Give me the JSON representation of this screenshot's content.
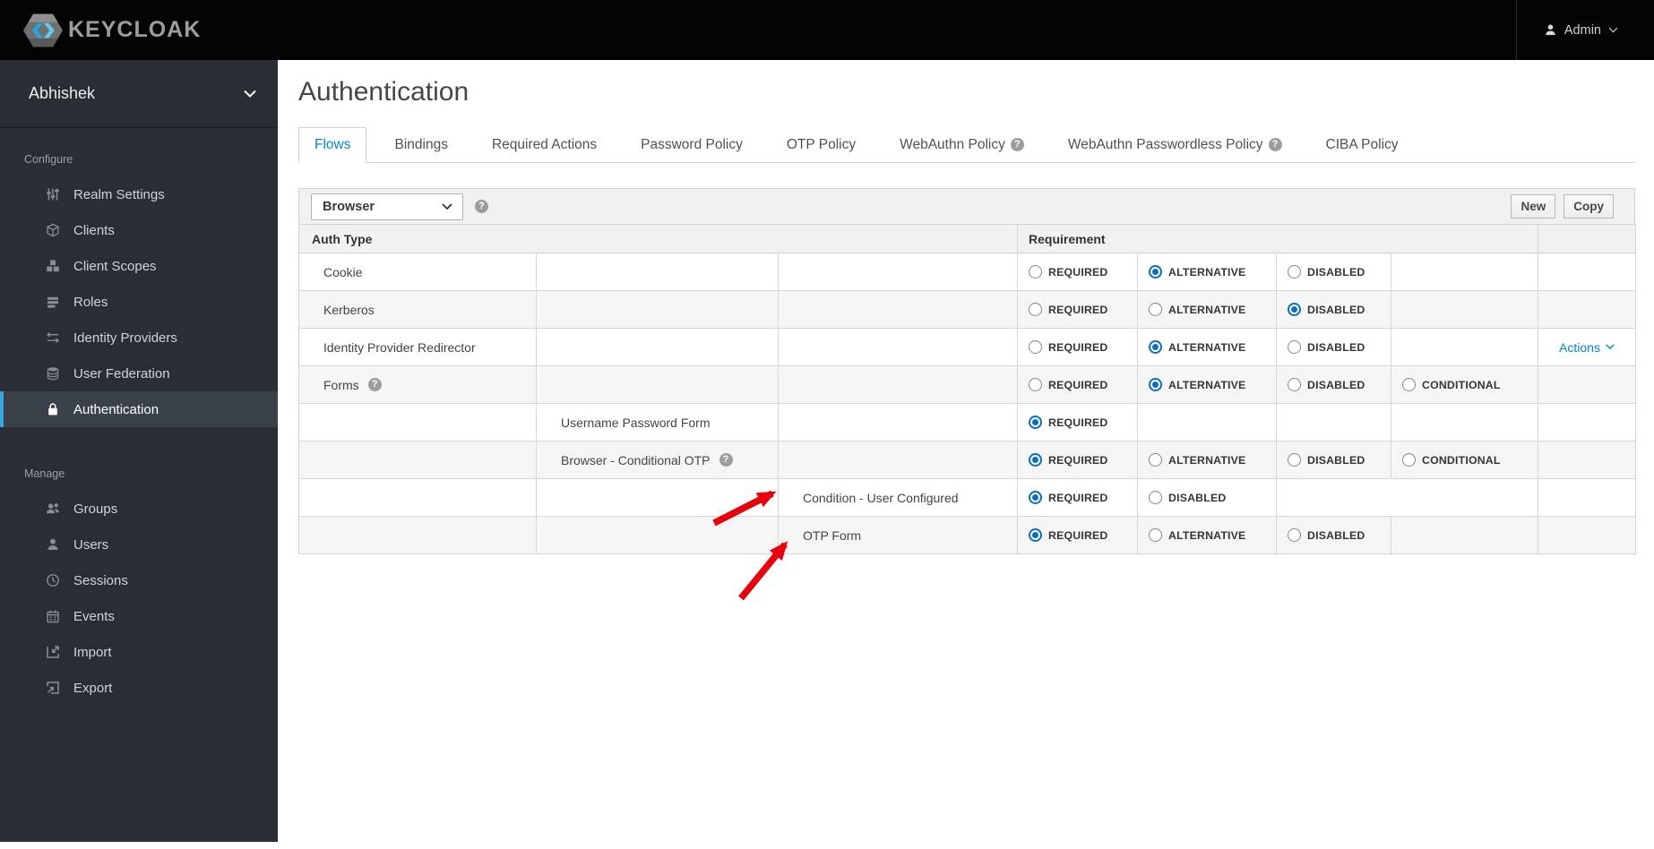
{
  "topbar": {
    "logo_text": "KEYCLOAK",
    "user_label": "Admin"
  },
  "sidebar": {
    "realm": "Abhishek",
    "sections": [
      {
        "label": "Configure",
        "items": [
          {
            "label": "Realm Settings",
            "icon": "sliders-icon",
            "active": false
          },
          {
            "label": "Clients",
            "icon": "cube-icon",
            "active": false
          },
          {
            "label": "Client Scopes",
            "icon": "cubes-icon",
            "active": false
          },
          {
            "label": "Roles",
            "icon": "list-icon",
            "active": false
          },
          {
            "label": "Identity Providers",
            "icon": "exchange-icon",
            "active": false
          },
          {
            "label": "User Federation",
            "icon": "database-icon",
            "active": false
          },
          {
            "label": "Authentication",
            "icon": "lock-icon",
            "active": true
          }
        ]
      },
      {
        "label": "Manage",
        "items": [
          {
            "label": "Groups",
            "icon": "users-icon",
            "active": false
          },
          {
            "label": "Users",
            "icon": "user-icon",
            "active": false
          },
          {
            "label": "Sessions",
            "icon": "clock-icon",
            "active": false
          },
          {
            "label": "Events",
            "icon": "calendar-icon",
            "active": false
          },
          {
            "label": "Import",
            "icon": "import-icon",
            "active": false
          },
          {
            "label": "Export",
            "icon": "export-icon",
            "active": false
          }
        ]
      }
    ]
  },
  "page": {
    "title": "Authentication"
  },
  "tabs": [
    {
      "label": "Flows",
      "active": true,
      "help": false
    },
    {
      "label": "Bindings",
      "active": false,
      "help": false
    },
    {
      "label": "Required Actions",
      "active": false,
      "help": false
    },
    {
      "label": "Password Policy",
      "active": false,
      "help": false
    },
    {
      "label": "OTP Policy",
      "active": false,
      "help": false
    },
    {
      "label": "WebAuthn Policy",
      "active": false,
      "help": true
    },
    {
      "label": "WebAuthn Passwordless Policy",
      "active": false,
      "help": true
    },
    {
      "label": "CIBA Policy",
      "active": false,
      "help": false
    }
  ],
  "toolbar": {
    "flow_select_value": "Browser",
    "new_label": "New",
    "copy_label": "Copy"
  },
  "table": {
    "headers": {
      "auth_type": "Auth Type",
      "requirement": "Requirement"
    },
    "rows": [
      {
        "label": "Cookie",
        "level": 1,
        "help": false,
        "options": [
          {
            "label": "REQUIRED",
            "slot": 0,
            "selected": false
          },
          {
            "label": "ALTERNATIVE",
            "slot": 1,
            "selected": true
          },
          {
            "label": "DISABLED",
            "slot": 2,
            "selected": false
          }
        ]
      },
      {
        "label": "Kerberos",
        "level": 1,
        "help": false,
        "options": [
          {
            "label": "REQUIRED",
            "slot": 0,
            "selected": false
          },
          {
            "label": "ALTERNATIVE",
            "slot": 1,
            "selected": false
          },
          {
            "label": "DISABLED",
            "slot": 2,
            "selected": true
          }
        ]
      },
      {
        "label": "Identity Provider Redirector",
        "level": 1,
        "help": false,
        "actions_label": "Actions",
        "options": [
          {
            "label": "REQUIRED",
            "slot": 0,
            "selected": false
          },
          {
            "label": "ALTERNATIVE",
            "slot": 1,
            "selected": true
          },
          {
            "label": "DISABLED",
            "slot": 2,
            "selected": false
          }
        ]
      },
      {
        "label": "Forms",
        "level": 1,
        "help": true,
        "options": [
          {
            "label": "REQUIRED",
            "slot": 0,
            "selected": false
          },
          {
            "label": "ALTERNATIVE",
            "slot": 1,
            "selected": true
          },
          {
            "label": "DISABLED",
            "slot": 2,
            "selected": false
          },
          {
            "label": "CONDITIONAL",
            "slot": 3,
            "selected": false
          }
        ]
      },
      {
        "label": "Username Password Form",
        "level": 2,
        "help": false,
        "options": [
          {
            "label": "REQUIRED",
            "slot": 0,
            "selected": true
          }
        ]
      },
      {
        "label": "Browser - Conditional OTP",
        "level": 2,
        "help": true,
        "options": [
          {
            "label": "REQUIRED",
            "slot": 0,
            "selected": true
          },
          {
            "label": "ALTERNATIVE",
            "slot": 1,
            "selected": false
          },
          {
            "label": "DISABLED",
            "slot": 2,
            "selected": false
          },
          {
            "label": "CONDITIONAL",
            "slot": 3,
            "selected": false
          }
        ]
      },
      {
        "label": "Condition - User Configured",
        "level": 3,
        "help": false,
        "span_rest": true,
        "options": [
          {
            "label": "REQUIRED",
            "slot": 0,
            "selected": true
          },
          {
            "label": "DISABLED",
            "slot": 1,
            "selected": false
          }
        ]
      },
      {
        "label": "OTP Form",
        "level": 3,
        "help": false,
        "options": [
          {
            "label": "REQUIRED",
            "slot": 0,
            "selected": true
          },
          {
            "label": "ALTERNATIVE",
            "slot": 1,
            "selected": false
          },
          {
            "label": "DISABLED",
            "slot": 2,
            "selected": false
          }
        ]
      }
    ]
  },
  "annotations": {
    "arrow_color": "#e8000d",
    "arrows": [
      {
        "name": "arrow-to-condition-user-configured"
      },
      {
        "name": "arrow-to-otp-form"
      }
    ]
  },
  "colors": {
    "accent_blue": "#0088ce",
    "radio_selected": "#0a6ebd",
    "sidebar_active_bar": "#39a5dc"
  }
}
